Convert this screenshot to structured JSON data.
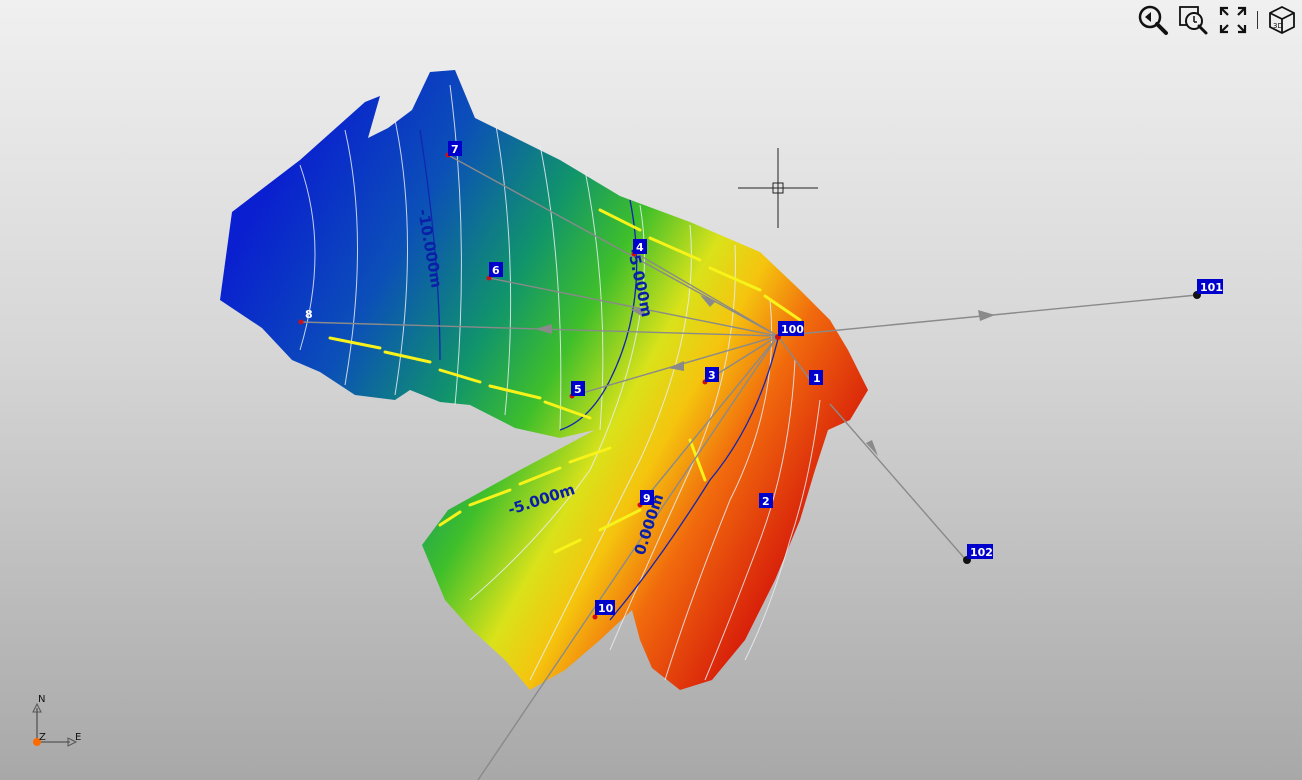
{
  "toolbar": {
    "buttons": [
      {
        "name": "zoom-previous-button",
        "icon": "zoom-back-icon"
      },
      {
        "name": "zoom-window-button",
        "icon": "zoom-window-icon"
      },
      {
        "name": "zoom-extents-button",
        "icon": "zoom-extents-icon"
      },
      {
        "name": "view-3d-button",
        "icon": "cube-3d-icon"
      }
    ]
  },
  "contours": {
    "label_minus_10": "-10.000m",
    "label_minus_5a": "-5.000m",
    "label_minus_5b": "-5.000m",
    "label_zero": "0.000m"
  },
  "stations": {
    "s100": "100",
    "s101": "101",
    "s102": "102"
  },
  "points": {
    "p1": "1",
    "p2": "2",
    "p3": "3",
    "p4": "4",
    "p5": "5",
    "p6": "6",
    "p7": "7",
    "p8": "8",
    "p9": "9",
    "p10": "10"
  },
  "compass": {
    "north": "N",
    "east": "E",
    "up": "Z"
  },
  "colors": {
    "deep": "#0a2fd6",
    "mid": "#1fae3a",
    "shallow": "#f2e60f",
    "high": "#e31a0a",
    "marker_bg": "#0000cc",
    "leader": "#8a8a8a"
  }
}
